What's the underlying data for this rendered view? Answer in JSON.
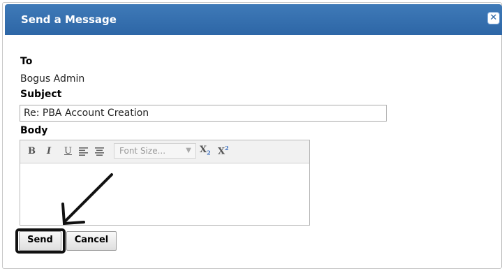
{
  "dialog": {
    "title": "Send a Message",
    "close_icon": "close-icon"
  },
  "form": {
    "to_label": "To",
    "to_value": "Bogus Admin",
    "subject_label": "Subject",
    "subject_value": "Re: PBA Account Creation",
    "body_label": "Body",
    "body_value": ""
  },
  "editor_toolbar": {
    "bold": "B",
    "italic": "I",
    "underline": "U",
    "align_left_icon": "align-left-icon",
    "align_center_icon": "align-center-icon",
    "font_size_placeholder": "Font Size...",
    "subscript_icon": "subscript-icon",
    "superscript_icon": "superscript-icon"
  },
  "buttons": {
    "send": "Send",
    "cancel": "Cancel"
  },
  "annotation": {
    "arrow_color": "#111111",
    "highlight_color": "#111111"
  },
  "colors": {
    "titlebar": "#2d66a6",
    "title_text": "#ffffff"
  }
}
